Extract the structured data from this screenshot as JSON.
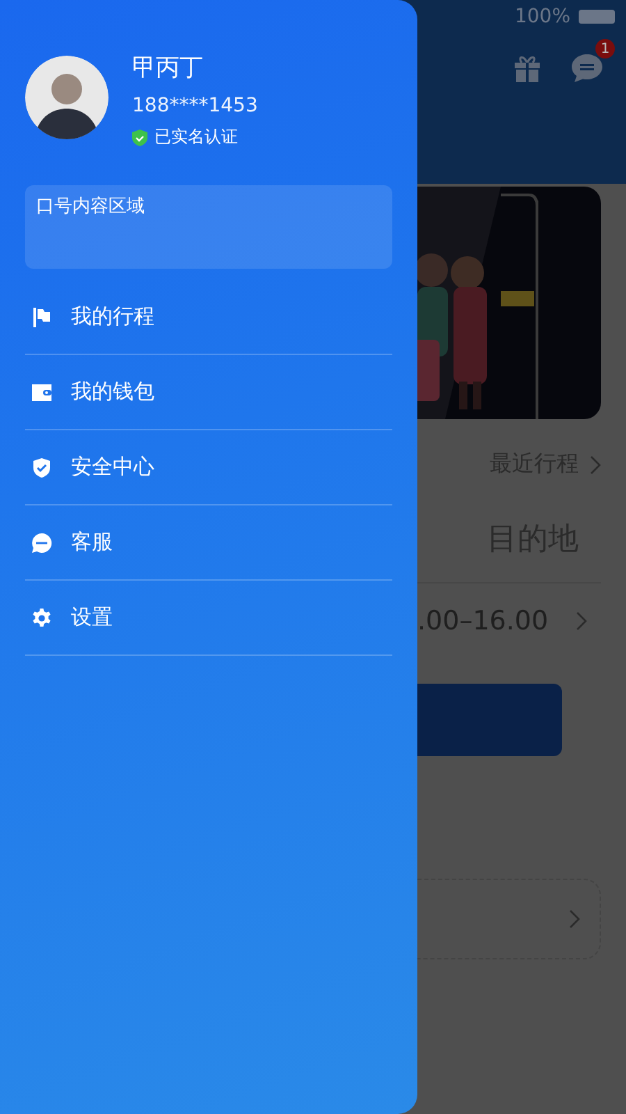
{
  "status_bar": {
    "battery": "100%"
  },
  "background_page": {
    "message_badge": "1",
    "recent_trips_link": "最近行程",
    "destination_label": "目的地",
    "time_range": ".00–16.00"
  },
  "drawer": {
    "user": {
      "name": "甲丙丁",
      "phone": "188****1453",
      "verification": "已实名认证"
    },
    "notice_area": "口号内容区域",
    "menu": [
      {
        "kind": "trips",
        "label": "我的行程"
      },
      {
        "kind": "wallet",
        "label": "我的钱包"
      },
      {
        "kind": "security",
        "label": "安全中心"
      },
      {
        "kind": "service",
        "label": "客服"
      },
      {
        "kind": "settings",
        "label": "设置"
      }
    ]
  }
}
